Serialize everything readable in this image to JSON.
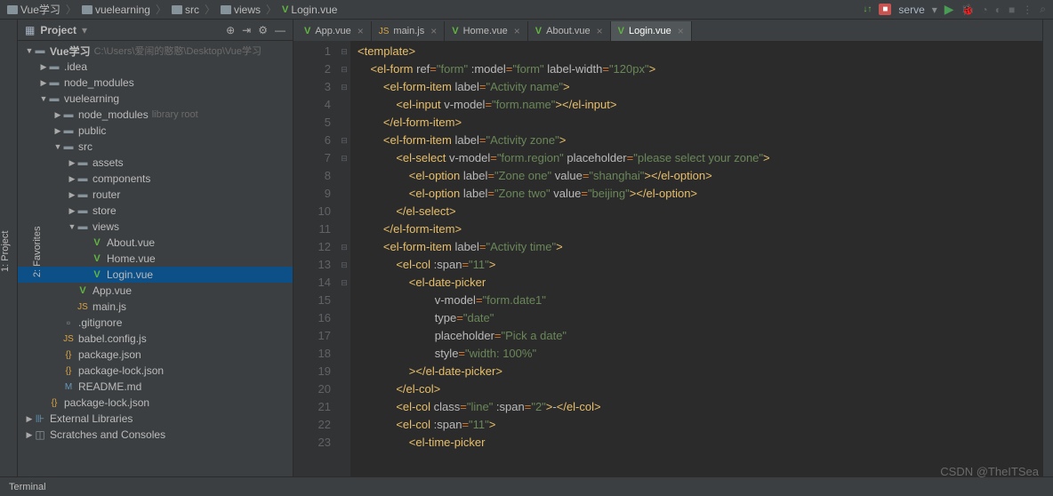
{
  "breadcrumb": [
    {
      "icon": "folder",
      "label": "Vue学习"
    },
    {
      "icon": "folder",
      "label": "vuelearning"
    },
    {
      "icon": "folder",
      "label": "src"
    },
    {
      "icon": "folder",
      "label": "views"
    },
    {
      "icon": "vue",
      "label": "Login.vue"
    }
  ],
  "toolbar": {
    "run_config": "serve",
    "signal": "↓↑"
  },
  "panel": {
    "title": "Project"
  },
  "tree": [
    {
      "depth": 0,
      "arrow": "▼",
      "icon": "folder",
      "name": "Vue学习",
      "dim": "C:\\Users\\爱闹的憨憨\\Desktop\\Vue学习",
      "bold": true
    },
    {
      "depth": 1,
      "arrow": "▶",
      "icon": "folder",
      "name": ".idea"
    },
    {
      "depth": 1,
      "arrow": "▶",
      "icon": "folder",
      "name": "node_modules"
    },
    {
      "depth": 1,
      "arrow": "▼",
      "icon": "folder",
      "name": "vuelearning"
    },
    {
      "depth": 2,
      "arrow": "▶",
      "icon": "folder",
      "name": "node_modules",
      "dim": "library root"
    },
    {
      "depth": 2,
      "arrow": "▶",
      "icon": "folder",
      "name": "public"
    },
    {
      "depth": 2,
      "arrow": "▼",
      "icon": "folder",
      "name": "src"
    },
    {
      "depth": 3,
      "arrow": "▶",
      "icon": "folder",
      "name": "assets"
    },
    {
      "depth": 3,
      "arrow": "▶",
      "icon": "folder",
      "name": "components"
    },
    {
      "depth": 3,
      "arrow": "▶",
      "icon": "folder",
      "name": "router"
    },
    {
      "depth": 3,
      "arrow": "▶",
      "icon": "folder",
      "name": "store"
    },
    {
      "depth": 3,
      "arrow": "▼",
      "icon": "folder",
      "name": "views"
    },
    {
      "depth": 4,
      "arrow": "",
      "icon": "vue",
      "name": "About.vue"
    },
    {
      "depth": 4,
      "arrow": "",
      "icon": "vue",
      "name": "Home.vue"
    },
    {
      "depth": 4,
      "arrow": "",
      "icon": "vue",
      "name": "Login.vue",
      "selected": true
    },
    {
      "depth": 3,
      "arrow": "",
      "icon": "vue",
      "name": "App.vue"
    },
    {
      "depth": 3,
      "arrow": "",
      "icon": "js",
      "name": "main.js"
    },
    {
      "depth": 2,
      "arrow": "",
      "icon": "file",
      "name": ".gitignore"
    },
    {
      "depth": 2,
      "arrow": "",
      "icon": "js",
      "name": "babel.config.js"
    },
    {
      "depth": 2,
      "arrow": "",
      "icon": "json",
      "name": "package.json"
    },
    {
      "depth": 2,
      "arrow": "",
      "icon": "json",
      "name": "package-lock.json"
    },
    {
      "depth": 2,
      "arrow": "",
      "icon": "md",
      "name": "README.md"
    },
    {
      "depth": 1,
      "arrow": "",
      "icon": "json",
      "name": "package-lock.json"
    },
    {
      "depth": 0,
      "arrow": "▶",
      "icon": "lib",
      "name": "External Libraries"
    },
    {
      "depth": 0,
      "arrow": "▶",
      "icon": "scratch",
      "name": "Scratches and Consoles"
    }
  ],
  "tabs": [
    {
      "icon": "vue",
      "label": "App.vue"
    },
    {
      "icon": "js",
      "label": "main.js"
    },
    {
      "icon": "vue",
      "label": "Home.vue"
    },
    {
      "icon": "vue",
      "label": "About.vue"
    },
    {
      "icon": "vue",
      "label": "Login.vue",
      "active": true
    }
  ],
  "code": [
    [
      {
        "t": "tag",
        "v": "<template>"
      }
    ],
    [
      {
        "t": "txt",
        "v": "    "
      },
      {
        "t": "tag",
        "v": "<el-form "
      },
      {
        "t": "attr",
        "v": "ref"
      },
      {
        "t": "op",
        "v": "="
      },
      {
        "t": "str",
        "v": "\"form\""
      },
      {
        "t": "attr",
        "v": " :model"
      },
      {
        "t": "op",
        "v": "="
      },
      {
        "t": "str",
        "v": "\"form\""
      },
      {
        "t": "attr",
        "v": " label-width"
      },
      {
        "t": "op",
        "v": "="
      },
      {
        "t": "str",
        "v": "\"120px\""
      },
      {
        "t": "tag",
        "v": ">"
      }
    ],
    [
      {
        "t": "txt",
        "v": "        "
      },
      {
        "t": "tag",
        "v": "<el-form-item "
      },
      {
        "t": "attr",
        "v": "label"
      },
      {
        "t": "op",
        "v": "="
      },
      {
        "t": "str",
        "v": "\"Activity name\""
      },
      {
        "t": "tag",
        "v": ">"
      }
    ],
    [
      {
        "t": "txt",
        "v": "            "
      },
      {
        "t": "tag",
        "v": "<el-input "
      },
      {
        "t": "attr",
        "v": "v-model"
      },
      {
        "t": "op",
        "v": "="
      },
      {
        "t": "str",
        "v": "\"form.name\""
      },
      {
        "t": "tag",
        "v": "></el-input>"
      }
    ],
    [
      {
        "t": "txt",
        "v": "        "
      },
      {
        "t": "tag",
        "v": "</el-form-item>"
      }
    ],
    [
      {
        "t": "txt",
        "v": "        "
      },
      {
        "t": "tag",
        "v": "<el-form-item "
      },
      {
        "t": "attr",
        "v": "label"
      },
      {
        "t": "op",
        "v": "="
      },
      {
        "t": "str",
        "v": "\"Activity zone\""
      },
      {
        "t": "tag",
        "v": ">"
      }
    ],
    [
      {
        "t": "txt",
        "v": "            "
      },
      {
        "t": "tag",
        "v": "<el-select "
      },
      {
        "t": "attr",
        "v": "v-model"
      },
      {
        "t": "op",
        "v": "="
      },
      {
        "t": "str",
        "v": "\"form.region\""
      },
      {
        "t": "attr",
        "v": " placeholder"
      },
      {
        "t": "op",
        "v": "="
      },
      {
        "t": "str",
        "v": "\"please select your zone\""
      },
      {
        "t": "tag",
        "v": ">"
      }
    ],
    [
      {
        "t": "txt",
        "v": "                "
      },
      {
        "t": "tag",
        "v": "<el-option "
      },
      {
        "t": "attr",
        "v": "label"
      },
      {
        "t": "op",
        "v": "="
      },
      {
        "t": "str",
        "v": "\"Zone one\""
      },
      {
        "t": "attr",
        "v": " value"
      },
      {
        "t": "op",
        "v": "="
      },
      {
        "t": "str",
        "v": "\"shanghai\""
      },
      {
        "t": "tag",
        "v": "></el-option>"
      }
    ],
    [
      {
        "t": "txt",
        "v": "                "
      },
      {
        "t": "tag",
        "v": "<el-option "
      },
      {
        "t": "attr",
        "v": "label"
      },
      {
        "t": "op",
        "v": "="
      },
      {
        "t": "str",
        "v": "\"Zone two\""
      },
      {
        "t": "attr",
        "v": " value"
      },
      {
        "t": "op",
        "v": "="
      },
      {
        "t": "str",
        "v": "\"beijing\""
      },
      {
        "t": "tag",
        "v": "></el-option>"
      }
    ],
    [
      {
        "t": "txt",
        "v": "            "
      },
      {
        "t": "tag",
        "v": "</el-select>"
      }
    ],
    [
      {
        "t": "txt",
        "v": "        "
      },
      {
        "t": "tag",
        "v": "</el-form-item>"
      }
    ],
    [
      {
        "t": "txt",
        "v": "        "
      },
      {
        "t": "tag",
        "v": "<el-form-item "
      },
      {
        "t": "attr",
        "v": "label"
      },
      {
        "t": "op",
        "v": "="
      },
      {
        "t": "str",
        "v": "\"Activity time\""
      },
      {
        "t": "tag",
        "v": ">"
      }
    ],
    [
      {
        "t": "txt",
        "v": "            "
      },
      {
        "t": "tag",
        "v": "<el-col "
      },
      {
        "t": "attr",
        "v": ":span"
      },
      {
        "t": "op",
        "v": "="
      },
      {
        "t": "str",
        "v": "\"11\""
      },
      {
        "t": "tag",
        "v": ">"
      }
    ],
    [
      {
        "t": "txt",
        "v": "                "
      },
      {
        "t": "tag",
        "v": "<el-date-picker"
      }
    ],
    [
      {
        "t": "txt",
        "v": "                        "
      },
      {
        "t": "attr",
        "v": "v-model"
      },
      {
        "t": "op",
        "v": "="
      },
      {
        "t": "str",
        "v": "\"form.date1\""
      }
    ],
    [
      {
        "t": "txt",
        "v": "                        "
      },
      {
        "t": "attr",
        "v": "type"
      },
      {
        "t": "op",
        "v": "="
      },
      {
        "t": "str",
        "v": "\"date\""
      }
    ],
    [
      {
        "t": "txt",
        "v": "                        "
      },
      {
        "t": "attr",
        "v": "placeholder"
      },
      {
        "t": "op",
        "v": "="
      },
      {
        "t": "str",
        "v": "\"Pick a date\""
      }
    ],
    [
      {
        "t": "txt",
        "v": "                        "
      },
      {
        "t": "attr",
        "v": "style"
      },
      {
        "t": "op",
        "v": "="
      },
      {
        "t": "str",
        "v": "\"width: 100%\""
      }
    ],
    [
      {
        "t": "txt",
        "v": "                "
      },
      {
        "t": "tag",
        "v": "></el-date-picker>"
      }
    ],
    [
      {
        "t": "txt",
        "v": "            "
      },
      {
        "t": "tag",
        "v": "</el-col>"
      }
    ],
    [
      {
        "t": "txt",
        "v": "            "
      },
      {
        "t": "tag",
        "v": "<el-col "
      },
      {
        "t": "attr",
        "v": "class"
      },
      {
        "t": "op",
        "v": "="
      },
      {
        "t": "str",
        "v": "\"line\""
      },
      {
        "t": "attr",
        "v": " :span"
      },
      {
        "t": "op",
        "v": "="
      },
      {
        "t": "str",
        "v": "\"2\""
      },
      {
        "t": "tag",
        "v": ">"
      },
      {
        "t": "txt",
        "v": "-"
      },
      {
        "t": "tag",
        "v": "</el-col>"
      }
    ],
    [
      {
        "t": "txt",
        "v": "            "
      },
      {
        "t": "tag",
        "v": "<el-col "
      },
      {
        "t": "attr",
        "v": ":span"
      },
      {
        "t": "op",
        "v": "="
      },
      {
        "t": "str",
        "v": "\"11\""
      },
      {
        "t": "tag",
        "v": ">"
      }
    ],
    [
      {
        "t": "txt",
        "v": "                "
      },
      {
        "t": "tag",
        "v": "<el-time-picker"
      }
    ]
  ],
  "line_start": 1,
  "line_end": 23,
  "bottom": {
    "terminal": "Terminal"
  },
  "sidebar_tabs": {
    "project": "1: Project",
    "favorites": "2: Favorites"
  },
  "watermark": "CSDN @TheITSea"
}
